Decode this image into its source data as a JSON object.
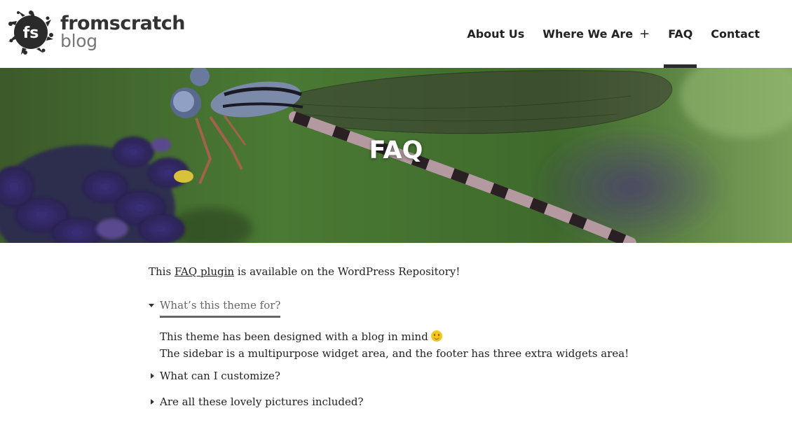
{
  "logo": {
    "mark_text": "fs",
    "line1": "fromscratch",
    "line2": "blog"
  },
  "nav": {
    "items": [
      {
        "label": "About Us",
        "has_submenu": false,
        "active": false
      },
      {
        "label": "Where We Are",
        "has_submenu": true,
        "active": false,
        "submenu_icon": "+"
      },
      {
        "label": "FAQ",
        "has_submenu": false,
        "active": true
      },
      {
        "label": "Contact",
        "has_submenu": false,
        "active": false
      }
    ]
  },
  "hero": {
    "title": "FAQ",
    "image": "dragonfly-on-lavender"
  },
  "intro": {
    "before": "This ",
    "link": "FAQ plugin",
    "after": " is available on the WordPress Repository!"
  },
  "faq": [
    {
      "question": "What’s this theme for?",
      "expanded": true,
      "answer_line1": "This theme has been designed with a blog in mind",
      "answer_line2": "The sidebar is a multipurpose widget area, and the footer has three extra widgets area!"
    },
    {
      "question": "What can I customize?",
      "expanded": false
    },
    {
      "question": "Are all these lovely pictures included?",
      "expanded": false
    }
  ],
  "colors": {
    "text": "#222222",
    "active_underline": "#2b2b2b",
    "muted": "#666666"
  }
}
